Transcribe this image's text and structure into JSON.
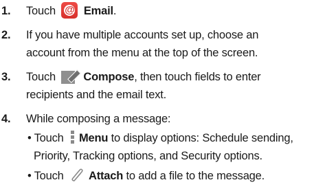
{
  "steps": [
    {
      "number": "1.",
      "pre": "Touch",
      "icon": "email-app-icon",
      "bold": "Email",
      "post": "."
    },
    {
      "number": "2.",
      "line1": "If you have multiple accounts set up, choose an",
      "line2": "account from the menu at the top of the screen."
    },
    {
      "number": "3.",
      "pre": "Touch",
      "icon": "compose-icon",
      "bold": "Compose",
      "post": ", then touch fields to enter",
      "line2": "recipients and the email text."
    },
    {
      "number": "4.",
      "text": "While composing a message:",
      "bullets": [
        {
          "marker": "•",
          "pre": "Touch",
          "icon": "menu-icon",
          "bold": "Menu",
          "post": " to display options: Schedule sending,",
          "line2": "Priority, Tracking options, and Security options."
        },
        {
          "marker": "•",
          "pre": "Touch",
          "icon": "attach-icon",
          "bold": "Attach",
          "post": " to add a file to the message."
        }
      ]
    }
  ],
  "colors": {
    "email_icon": "#e03a36",
    "compose_icon": "#8f8f8f",
    "menu_icon": "#8a8a8a",
    "attach_icon": "#8a8a8a",
    "text": "#1a1a1a"
  }
}
